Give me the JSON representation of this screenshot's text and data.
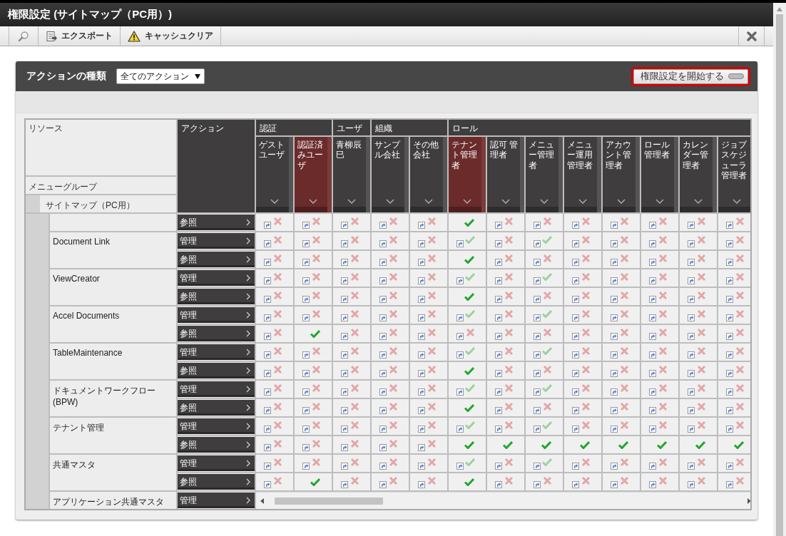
{
  "window": {
    "title": "権限設定 (サイトマップ（PC用）)"
  },
  "toolbar": {
    "export": "エクスポート",
    "cache_clear": "キャッシュクリア"
  },
  "panel": {
    "filter_label": "アクションの種類",
    "filter_value": "全てのアクション",
    "start_button": {
      "label": "権限設定を開始する",
      "highlighted": true
    }
  },
  "table": {
    "resource_header": "リソース",
    "menu_group_header": "メニューグループ",
    "sitemap_label": "サイトマップ（PC用）",
    "action_header": "アクション",
    "column_groups": [
      {
        "label": "認証",
        "columns": [
          {
            "label": "ゲストユーザ",
            "highlighted": false
          },
          {
            "label": "認証済みユーザ",
            "highlighted": true
          }
        ]
      },
      {
        "label": "ユーザ",
        "columns": [
          {
            "label": "青柳辰巳",
            "highlighted": false
          }
        ]
      },
      {
        "label": "組織",
        "columns": [
          {
            "label": "サンプル会社",
            "highlighted": false
          },
          {
            "label": "その他会社",
            "highlighted": false
          }
        ]
      },
      {
        "label": "ロール",
        "columns": [
          {
            "label": "テナント管理者",
            "highlighted": true
          },
          {
            "label": "認可 管理者",
            "highlighted": false
          },
          {
            "label": "メニュー管理者",
            "highlighted": false
          },
          {
            "label": "メニュー運用管理者",
            "highlighted": false
          },
          {
            "label": "アカウント管理者",
            "highlighted": false
          },
          {
            "label": "ロール管理者",
            "highlighted": false
          },
          {
            "label": "カレンダー管理者",
            "highlighted": false
          },
          {
            "label": "ジョブスケジューラ管理者",
            "highlighted": false
          }
        ]
      }
    ],
    "resource_groups": [
      {
        "actions": [
          {
            "label": "参照",
            "cells": [
              {
                "allowed": false,
                "inherited": true
              },
              {
                "allowed": false,
                "inherited": true
              },
              {
                "allowed": false,
                "inherited": true
              },
              {
                "allowed": false,
                "inherited": true
              },
              {
                "allowed": false,
                "inherited": true
              },
              {
                "allowed": true,
                "inherited": false
              },
              {
                "allowed": false,
                "inherited": true
              },
              {
                "allowed": false,
                "inherited": true
              },
              {
                "allowed": false,
                "inherited": true
              },
              {
                "allowed": false,
                "inherited": true
              },
              {
                "allowed": false,
                "inherited": true
              },
              {
                "allowed": false,
                "inherited": true
              },
              {
                "allowed": false,
                "inherited": true
              }
            ]
          }
        ]
      },
      {
        "name": "Document Link",
        "actions": [
          {
            "label": "管理",
            "cells": [
              {
                "allowed": false,
                "inherited": true
              },
              {
                "allowed": false,
                "inherited": true
              },
              {
                "allowed": false,
                "inherited": true
              },
              {
                "allowed": false,
                "inherited": true
              },
              {
                "allowed": false,
                "inherited": true
              },
              {
                "allowed": true,
                "inherited": true
              },
              {
                "allowed": false,
                "inherited": true
              },
              {
                "allowed": true,
                "inherited": true
              },
              {
                "allowed": false,
                "inherited": true
              },
              {
                "allowed": false,
                "inherited": true
              },
              {
                "allowed": false,
                "inherited": true
              },
              {
                "allowed": false,
                "inherited": true
              },
              {
                "allowed": false,
                "inherited": true
              }
            ]
          },
          {
            "label": "参照",
            "cells": [
              {
                "allowed": false,
                "inherited": true
              },
              {
                "allowed": false,
                "inherited": true
              },
              {
                "allowed": false,
                "inherited": true
              },
              {
                "allowed": false,
                "inherited": true
              },
              {
                "allowed": false,
                "inherited": true
              },
              {
                "allowed": true,
                "inherited": false
              },
              {
                "allowed": false,
                "inherited": true
              },
              {
                "allowed": false,
                "inherited": true
              },
              {
                "allowed": false,
                "inherited": true
              },
              {
                "allowed": false,
                "inherited": true
              },
              {
                "allowed": false,
                "inherited": true
              },
              {
                "allowed": false,
                "inherited": true
              },
              {
                "allowed": false,
                "inherited": true
              }
            ]
          }
        ]
      },
      {
        "name": "ViewCreator",
        "actions": [
          {
            "label": "管理",
            "cells": [
              {
                "allowed": false,
                "inherited": true
              },
              {
                "allowed": false,
                "inherited": true
              },
              {
                "allowed": false,
                "inherited": true
              },
              {
                "allowed": false,
                "inherited": true
              },
              {
                "allowed": false,
                "inherited": true
              },
              {
                "allowed": true,
                "inherited": true
              },
              {
                "allowed": false,
                "inherited": true
              },
              {
                "allowed": true,
                "inherited": true
              },
              {
                "allowed": false,
                "inherited": true
              },
              {
                "allowed": false,
                "inherited": true
              },
              {
                "allowed": false,
                "inherited": true
              },
              {
                "allowed": false,
                "inherited": true
              },
              {
                "allowed": false,
                "inherited": true
              }
            ]
          },
          {
            "label": "参照",
            "cells": [
              {
                "allowed": false,
                "inherited": true
              },
              {
                "allowed": false,
                "inherited": true
              },
              {
                "allowed": false,
                "inherited": true
              },
              {
                "allowed": false,
                "inherited": true
              },
              {
                "allowed": false,
                "inherited": true
              },
              {
                "allowed": true,
                "inherited": false
              },
              {
                "allowed": false,
                "inherited": true
              },
              {
                "allowed": false,
                "inherited": true
              },
              {
                "allowed": false,
                "inherited": true
              },
              {
                "allowed": false,
                "inherited": true
              },
              {
                "allowed": false,
                "inherited": true
              },
              {
                "allowed": false,
                "inherited": true
              },
              {
                "allowed": false,
                "inherited": true
              }
            ]
          }
        ]
      },
      {
        "name": "Accel Documents",
        "actions": [
          {
            "label": "管理",
            "cells": [
              {
                "allowed": false,
                "inherited": true
              },
              {
                "allowed": false,
                "inherited": true
              },
              {
                "allowed": false,
                "inherited": true
              },
              {
                "allowed": false,
                "inherited": true
              },
              {
                "allowed": false,
                "inherited": true
              },
              {
                "allowed": true,
                "inherited": true
              },
              {
                "allowed": false,
                "inherited": true
              },
              {
                "allowed": true,
                "inherited": true
              },
              {
                "allowed": false,
                "inherited": true
              },
              {
                "allowed": false,
                "inherited": true
              },
              {
                "allowed": false,
                "inherited": true
              },
              {
                "allowed": false,
                "inherited": true
              },
              {
                "allowed": false,
                "inherited": true
              }
            ]
          },
          {
            "label": "参照",
            "cells": [
              {
                "allowed": false,
                "inherited": true
              },
              {
                "allowed": true,
                "inherited": false
              },
              {
                "allowed": false,
                "inherited": true
              },
              {
                "allowed": false,
                "inherited": true
              },
              {
                "allowed": false,
                "inherited": true
              },
              {
                "allowed": false,
                "inherited": true
              },
              {
                "allowed": false,
                "inherited": true
              },
              {
                "allowed": false,
                "inherited": true
              },
              {
                "allowed": false,
                "inherited": true
              },
              {
                "allowed": false,
                "inherited": true
              },
              {
                "allowed": false,
                "inherited": true
              },
              {
                "allowed": false,
                "inherited": true
              },
              {
                "allowed": false,
                "inherited": true
              }
            ]
          }
        ]
      },
      {
        "name": "TableMaintenance",
        "actions": [
          {
            "label": "管理",
            "cells": [
              {
                "allowed": false,
                "inherited": true
              },
              {
                "allowed": false,
                "inherited": true
              },
              {
                "allowed": false,
                "inherited": true
              },
              {
                "allowed": false,
                "inherited": true
              },
              {
                "allowed": false,
                "inherited": true
              },
              {
                "allowed": true,
                "inherited": true
              },
              {
                "allowed": false,
                "inherited": true
              },
              {
                "allowed": true,
                "inherited": true
              },
              {
                "allowed": false,
                "inherited": true
              },
              {
                "allowed": false,
                "inherited": true
              },
              {
                "allowed": false,
                "inherited": true
              },
              {
                "allowed": false,
                "inherited": true
              },
              {
                "allowed": false,
                "inherited": true
              }
            ]
          },
          {
            "label": "参照",
            "cells": [
              {
                "allowed": false,
                "inherited": true
              },
              {
                "allowed": false,
                "inherited": true
              },
              {
                "allowed": false,
                "inherited": true
              },
              {
                "allowed": false,
                "inherited": true
              },
              {
                "allowed": false,
                "inherited": true
              },
              {
                "allowed": true,
                "inherited": false
              },
              {
                "allowed": false,
                "inherited": true
              },
              {
                "allowed": false,
                "inherited": true
              },
              {
                "allowed": false,
                "inherited": true
              },
              {
                "allowed": false,
                "inherited": true
              },
              {
                "allowed": false,
                "inherited": true
              },
              {
                "allowed": false,
                "inherited": true
              },
              {
                "allowed": false,
                "inherited": true
              }
            ]
          }
        ]
      },
      {
        "name": "ドキュメントワークフロー(BPW)",
        "actions": [
          {
            "label": "管理",
            "cells": [
              {
                "allowed": false,
                "inherited": true
              },
              {
                "allowed": false,
                "inherited": true
              },
              {
                "allowed": false,
                "inherited": true
              },
              {
                "allowed": false,
                "inherited": true
              },
              {
                "allowed": false,
                "inherited": true
              },
              {
                "allowed": true,
                "inherited": true
              },
              {
                "allowed": false,
                "inherited": true
              },
              {
                "allowed": true,
                "inherited": true
              },
              {
                "allowed": false,
                "inherited": true
              },
              {
                "allowed": false,
                "inherited": true
              },
              {
                "allowed": false,
                "inherited": true
              },
              {
                "allowed": false,
                "inherited": true
              },
              {
                "allowed": false,
                "inherited": true
              }
            ]
          },
          {
            "label": "参照",
            "cells": [
              {
                "allowed": false,
                "inherited": true
              },
              {
                "allowed": false,
                "inherited": true
              },
              {
                "allowed": false,
                "inherited": true
              },
              {
                "allowed": false,
                "inherited": true
              },
              {
                "allowed": false,
                "inherited": true
              },
              {
                "allowed": true,
                "inherited": false
              },
              {
                "allowed": false,
                "inherited": true
              },
              {
                "allowed": false,
                "inherited": true
              },
              {
                "allowed": false,
                "inherited": true
              },
              {
                "allowed": false,
                "inherited": true
              },
              {
                "allowed": false,
                "inherited": true
              },
              {
                "allowed": false,
                "inherited": true
              },
              {
                "allowed": false,
                "inherited": true
              }
            ]
          }
        ]
      },
      {
        "name": "テナント管理",
        "actions": [
          {
            "label": "管理",
            "cells": [
              {
                "allowed": false,
                "inherited": true
              },
              {
                "allowed": false,
                "inherited": true
              },
              {
                "allowed": false,
                "inherited": true
              },
              {
                "allowed": false,
                "inherited": true
              },
              {
                "allowed": false,
                "inherited": true
              },
              {
                "allowed": true,
                "inherited": true
              },
              {
                "allowed": false,
                "inherited": true
              },
              {
                "allowed": true,
                "inherited": true
              },
              {
                "allowed": false,
                "inherited": true
              },
              {
                "allowed": false,
                "inherited": true
              },
              {
                "allowed": false,
                "inherited": true
              },
              {
                "allowed": false,
                "inherited": true
              },
              {
                "allowed": false,
                "inherited": true
              }
            ]
          },
          {
            "label": "参照",
            "cells": [
              {
                "allowed": false,
                "inherited": true
              },
              {
                "allowed": false,
                "inherited": true
              },
              {
                "allowed": false,
                "inherited": true
              },
              {
                "allowed": false,
                "inherited": true
              },
              {
                "allowed": false,
                "inherited": true
              },
              {
                "allowed": true,
                "inherited": false
              },
              {
                "allowed": true,
                "inherited": false
              },
              {
                "allowed": true,
                "inherited": false
              },
              {
                "allowed": true,
                "inherited": false
              },
              {
                "allowed": true,
                "inherited": false
              },
              {
                "allowed": true,
                "inherited": false
              },
              {
                "allowed": true,
                "inherited": false
              },
              {
                "allowed": true,
                "inherited": false
              }
            ]
          }
        ]
      },
      {
        "name": "共通マスタ",
        "actions": [
          {
            "label": "管理",
            "cells": [
              {
                "allowed": false,
                "inherited": true
              },
              {
                "allowed": false,
                "inherited": true
              },
              {
                "allowed": false,
                "inherited": true
              },
              {
                "allowed": false,
                "inherited": true
              },
              {
                "allowed": false,
                "inherited": true
              },
              {
                "allowed": true,
                "inherited": true
              },
              {
                "allowed": false,
                "inherited": true
              },
              {
                "allowed": true,
                "inherited": true
              },
              {
                "allowed": false,
                "inherited": true
              },
              {
                "allowed": false,
                "inherited": true
              },
              {
                "allowed": false,
                "inherited": true
              },
              {
                "allowed": false,
                "inherited": true
              },
              {
                "allowed": false,
                "inherited": true
              }
            ]
          },
          {
            "label": "参照",
            "cells": [
              {
                "allowed": false,
                "inherited": true
              },
              {
                "allowed": true,
                "inherited": false
              },
              {
                "allowed": false,
                "inherited": true
              },
              {
                "allowed": false,
                "inherited": true
              },
              {
                "allowed": false,
                "inherited": true
              },
              {
                "allowed": true,
                "inherited": false
              },
              {
                "allowed": false,
                "inherited": true
              },
              {
                "allowed": false,
                "inherited": true
              },
              {
                "allowed": false,
                "inherited": true
              },
              {
                "allowed": false,
                "inherited": true
              },
              {
                "allowed": false,
                "inherited": true
              },
              {
                "allowed": false,
                "inherited": true
              },
              {
                "allowed": false,
                "inherited": true
              }
            ]
          }
        ]
      },
      {
        "name": "アプリケーション共通マスタ",
        "actions": [
          {
            "label": "管理"
          }
        ]
      }
    ]
  }
}
